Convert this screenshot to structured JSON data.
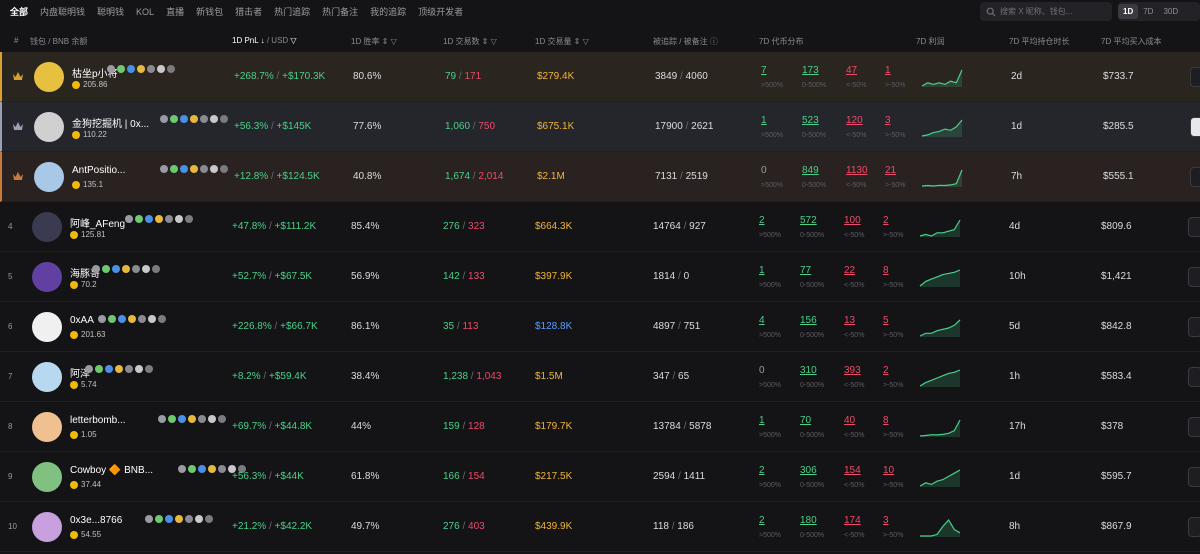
{
  "nav": {
    "tabs": [
      "全部",
      "内盘聪明钱",
      "聪明钱",
      "KOL",
      "直播",
      "新钱包",
      "猎击者",
      "热门追踪",
      "热门备注",
      "我的追踪",
      "顶级开发者"
    ],
    "active_tab": 0
  },
  "search": {
    "placeholder": "搜索 X 昵称、钱包..."
  },
  "periods": {
    "options": [
      "1D",
      "7D",
      "30D"
    ],
    "active": 0
  },
  "columns": {
    "rank": "#",
    "wallet": "钱包 / BNB 余额",
    "pnl": "1D PnL",
    "pnl_unit": "/ USD",
    "winrate": "1D 胜率",
    "tx": "1D 交易数",
    "volume": "1D 交易量",
    "follow": "被追踪 / 被备注",
    "dist": "7D 代币分布",
    "profit": "7D 利润",
    "hold": "7D 平均持仓时长",
    "cost": "7D 平均买入成本"
  },
  "dist_labels": [
    ">500%",
    "0-500%",
    "<-50%",
    ">-50%"
  ],
  "colors": {
    "positive": "#4ad08a",
    "negative": "#ef4a6a",
    "volume": "#f0b43c",
    "volume_alt": "#5a9cff",
    "gold": "#d8a030",
    "silver": "#9aa0b4",
    "bronze": "#c77a3c"
  },
  "rows": [
    {
      "rank": "1",
      "tier": "gold",
      "name": "枯坐p小将",
      "balance": "205.86",
      "pnl_pct": "+268.7%",
      "pnl_usd": "+$170.3K",
      "winrate": "80.6%",
      "buys": "79",
      "sells": "171",
      "volume": "$279.4K",
      "followers": "3849",
      "notes": "4060",
      "d1": "7",
      "d2": "173",
      "d3": "47",
      "d4": "1",
      "spark": [
        2,
        3,
        2.5,
        3,
        2.5,
        3.5,
        3,
        7
      ],
      "hold": "2d",
      "cost": "$733.7",
      "avatar_color": "#e8c040"
    },
    {
      "rank": "2",
      "tier": "silver",
      "name": "金狗挖掘机 | 0x...",
      "balance": "110.22",
      "pnl_pct": "+56.3%",
      "pnl_usd": "+$145K",
      "winrate": "77.6%",
      "buys": "1,060",
      "sells": "750",
      "volume": "$675.1K",
      "followers": "17900",
      "notes": "2621",
      "d1": "1",
      "d2": "523",
      "d3": "120",
      "d4": "3",
      "spark": [
        1,
        1.5,
        2.5,
        3,
        4,
        3.5,
        5,
        8
      ],
      "hold": "1d",
      "cost": "$285.5",
      "avatar_color": "#d0d0d0"
    },
    {
      "rank": "3",
      "tier": "bronze",
      "name": "AntPositio...",
      "balance": "135.1",
      "pnl_pct": "+12.8%",
      "pnl_usd": "+$124.5K",
      "winrate": "40.8%",
      "buys": "1,674",
      "sells": "2,014",
      "volume": "$2.1M",
      "followers": "7131",
      "notes": "2519",
      "d1": "0",
      "d2": "849",
      "d3": "1130",
      "d4": "21",
      "spark": [
        1,
        1.2,
        1,
        1.3,
        1.2,
        1.5,
        2,
        8
      ],
      "hold": "7h",
      "cost": "$555.1",
      "avatar_color": "#a8c8e8"
    },
    {
      "rank": "4",
      "tier": "",
      "name": "阿峰_AFeng",
      "balance": "125.81",
      "pnl_pct": "+47.8%",
      "pnl_usd": "+$111.2K",
      "winrate": "85.4%",
      "buys": "276",
      "sells": "323",
      "volume": "$664.3K",
      "followers": "14764",
      "notes": "927",
      "d1": "2",
      "d2": "572",
      "d3": "100",
      "d4": "2",
      "spark": [
        2,
        2.5,
        2,
        3,
        3,
        3.5,
        4,
        7
      ],
      "hold": "4d",
      "cost": "$809.6",
      "avatar_color": "#3a3a50"
    },
    {
      "rank": "5",
      "tier": "",
      "name": "海豚哥",
      "balance": "70.2",
      "pnl_pct": "+52.7%",
      "pnl_usd": "+$67.5K",
      "winrate": "56.9%",
      "buys": "142",
      "sells": "133",
      "volume": "$397.9K",
      "followers": "1814",
      "notes": "0",
      "d1": "1",
      "d2": "77",
      "d3": "22",
      "d4": "8",
      "spark": [
        1,
        3,
        4,
        5,
        6,
        6.5,
        7,
        8
      ],
      "hold": "10h",
      "cost": "$1,421",
      "avatar_color": "#6040a0"
    },
    {
      "rank": "6",
      "tier": "",
      "name": "0xAA",
      "balance": "201.63",
      "pnl_pct": "+226.8%",
      "pnl_usd": "+$66.7K",
      "winrate": "86.1%",
      "buys": "35",
      "sells": "113",
      "volume": "$128.8K",
      "followers": "4897",
      "notes": "751",
      "d1": "4",
      "d2": "156",
      "d3": "13",
      "d4": "5",
      "spark": [
        1,
        2,
        2,
        3,
        3.5,
        4,
        5,
        7
      ],
      "hold": "5d",
      "cost": "$842.8",
      "avatar_color": "#f0f0f0",
      "vol_alt": true
    },
    {
      "rank": "7",
      "tier": "",
      "name": "阿泽",
      "balance": "5.74",
      "pnl_pct": "+8.2%",
      "pnl_usd": "+$59.4K",
      "winrate": "38.4%",
      "buys": "1,238",
      "sells": "1,043",
      "volume": "$1.5M",
      "followers": "347",
      "notes": "65",
      "d1": "0",
      "d2": "310",
      "d3": "393",
      "d4": "2",
      "spark": [
        1,
        2.5,
        3.5,
        4.5,
        5.5,
        6.5,
        7,
        8
      ],
      "hold": "1h",
      "cost": "$583.4",
      "avatar_color": "#b8d8f0"
    },
    {
      "rank": "8",
      "tier": "",
      "name": "letterbomb...",
      "balance": "1.05",
      "pnl_pct": "+69.7%",
      "pnl_usd": "+$44.8K",
      "winrate": "44%",
      "buys": "159",
      "sells": "128",
      "volume": "$179.7K",
      "followers": "13784",
      "notes": "5878",
      "d1": "1",
      "d2": "70",
      "d3": "40",
      "d4": "8",
      "spark": [
        1,
        1.2,
        1.5,
        1.4,
        1.6,
        2,
        3,
        7
      ],
      "hold": "17h",
      "cost": "$378",
      "avatar_color": "#f0c090"
    },
    {
      "rank": "9",
      "tier": "",
      "name": "Cowboy 🔶 BNB...",
      "balance": "37.44",
      "pnl_pct": "+56.3%",
      "pnl_usd": "+$44K",
      "winrate": "61.8%",
      "buys": "166",
      "sells": "154",
      "volume": "$217.5K",
      "followers": "2594",
      "notes": "1411",
      "d1": "2",
      "d2": "306",
      "d3": "154",
      "d4": "10",
      "spark": [
        2,
        3,
        2.5,
        3.5,
        4,
        5,
        6,
        7
      ],
      "hold": "1d",
      "cost": "$595.7",
      "avatar_color": "#80c080"
    },
    {
      "rank": "10",
      "tier": "",
      "name": "0x3e...8766",
      "balance": "54.55",
      "pnl_pct": "+21.2%",
      "pnl_usd": "+$42.2K",
      "winrate": "49.7%",
      "buys": "276",
      "sells": "403",
      "volume": "$439.9K",
      "followers": "118",
      "notes": "186",
      "d1": "2",
      "d2": "180",
      "d3": "174",
      "d4": "3",
      "spark": [
        2,
        2,
        2,
        2.5,
        5,
        7,
        4,
        3
      ],
      "hold": "8h",
      "cost": "$867.9",
      "avatar_color": "#c8a0e0"
    }
  ]
}
